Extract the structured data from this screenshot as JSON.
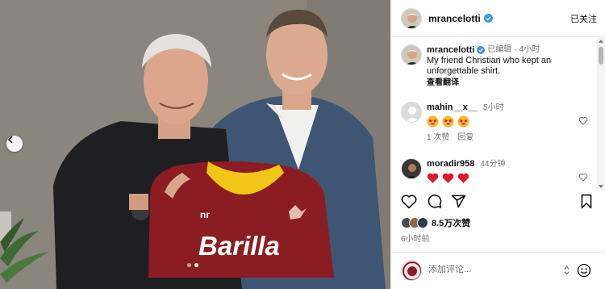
{
  "post": {
    "author": "mrancelotti",
    "follow_label": "已关注",
    "caption_username": "mrancelotti",
    "edited_label": "已编辑",
    "caption_time": "4小时",
    "caption_text": "My friend Christian who kept an unforgettable shirt.",
    "see_translation": "查看翻译",
    "carousel": {
      "total": 2,
      "active_index": 1
    }
  },
  "photo": {
    "jersey_text": "Barilla",
    "jersey_brand": "nr"
  },
  "comments": [
    {
      "username": "mahin__x__",
      "time": "5小时",
      "emojis": [
        "star-struck",
        "star-struck",
        "star-struck"
      ],
      "likes": "1 次赞",
      "reply": "回复"
    },
    {
      "username": "moradir958",
      "time": "44分钟",
      "emojis": [
        "red-heart",
        "red-heart",
        "red-heart"
      ]
    }
  ],
  "actions": {
    "icons": [
      "heart-icon",
      "comment-icon",
      "share-icon",
      "bookmark-icon"
    ]
  },
  "likes_count": "8.5万次赞",
  "time_ago": "6小时前",
  "add_comment": {
    "placeholder": "添加评论..."
  },
  "colors": {
    "verified": "#3897f0",
    "heart": "#e0182d",
    "jersey": "#8b1d22",
    "collar": "#f3c516"
  }
}
